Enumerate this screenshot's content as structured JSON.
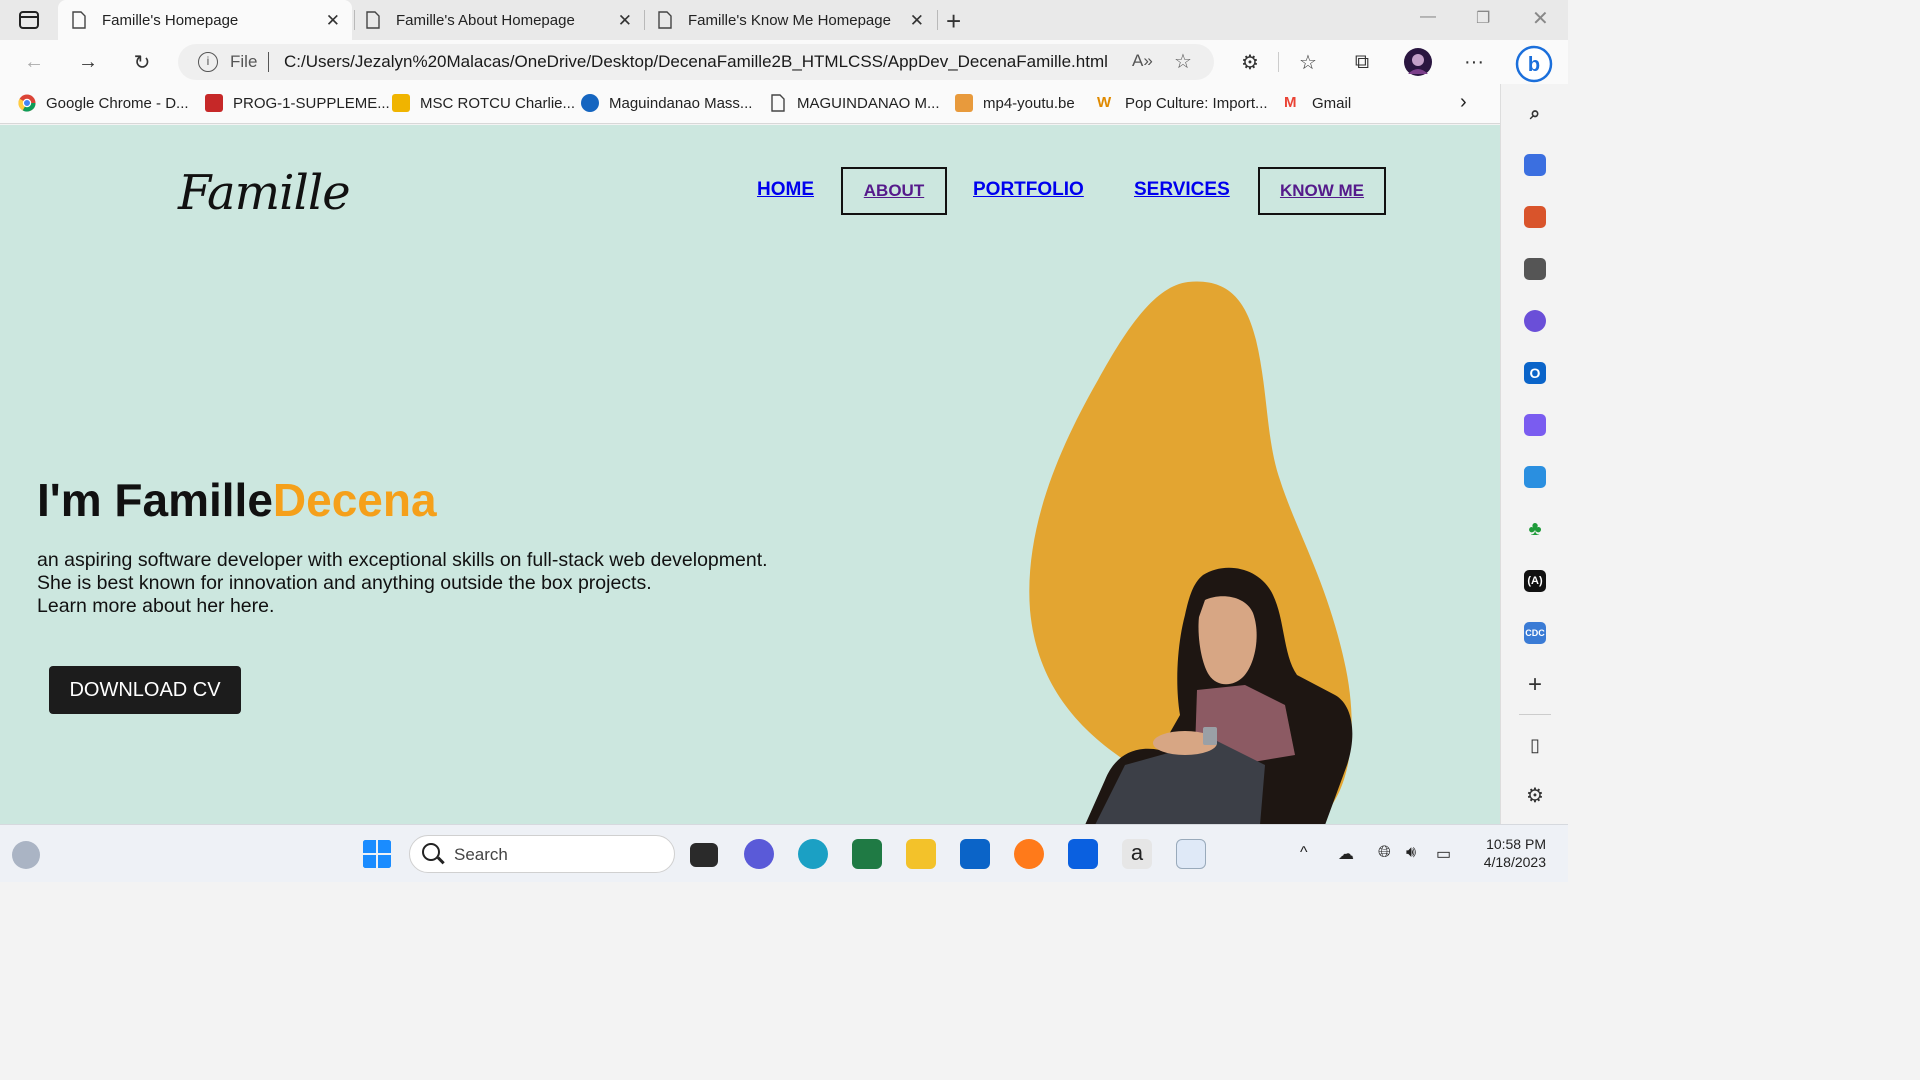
{
  "tabs": [
    {
      "title": "Famille's Homepage"
    },
    {
      "title": "Famille's About Homepage"
    },
    {
      "title": "Famille's Know Me Homepage"
    }
  ],
  "address": {
    "scheme_label": "File",
    "url": "C:/Users/Jezalyn%20Malacas/OneDrive/Desktop/DecenaFamille2B_HTMLCSS/AppDev_DecenaFamille.html"
  },
  "bookmarks": [
    {
      "label": "Google Chrome - D...",
      "color": "#4285f4"
    },
    {
      "label": "PROG-1-SUPPLEME...",
      "color": "#c62828"
    },
    {
      "label": "MSC ROTCU Charlie...",
      "color": "#f0b400"
    },
    {
      "label": "Maguindanao Mass...",
      "color": "#1565c0"
    },
    {
      "label": "MAGUINDANAO M...",
      "color": "#ffffff"
    },
    {
      "label": "mp4-youtu.be",
      "color": "#e89a3c"
    },
    {
      "label": "Pop Culture: Import...",
      "color": "#e08a00"
    },
    {
      "label": "Gmail",
      "color": "#ea4335"
    }
  ],
  "site": {
    "logo": "Famille",
    "nav": {
      "home": "HOME",
      "about": "ABOUT",
      "portfolio": "PORTFOLIO",
      "services": "SERVICES",
      "know_me": "KNOW ME"
    },
    "hero": {
      "title_main": "I'm Famille",
      "title_accent": "Decena",
      "line1": "an aspiring software developer with exceptional skills on full-stack web development.",
      "line2": "She is best known for innovation and anything outside the box projects.",
      "line3": "Learn more about her here.",
      "cta": "DOWNLOAD CV"
    },
    "colors": {
      "background": "#cce7df",
      "accent": "#f5a01a",
      "blob": "#e3a531",
      "button": "#1c1c1c"
    }
  },
  "taskbar": {
    "search_placeholder": "Search",
    "time": "10:58 PM",
    "date": "4/18/2023"
  }
}
